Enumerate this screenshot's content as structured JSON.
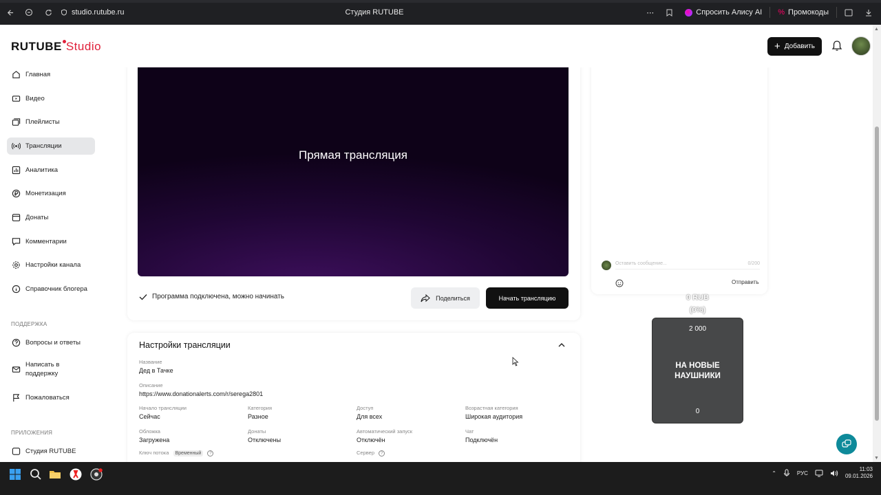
{
  "browser": {
    "url": "studio.rutube.ru",
    "page_title": "Студия RUTUBE",
    "alice_label": "Спросить Алису AI",
    "promo_label": "Промокоды"
  },
  "header": {
    "logo_main": "RUTUBE",
    "logo_studio": "Studio",
    "add_label": "Добавить"
  },
  "sidebar": {
    "items": [
      {
        "label": "Главная"
      },
      {
        "label": "Видео"
      },
      {
        "label": "Плейлисты"
      },
      {
        "label": "Трансляции"
      },
      {
        "label": "Аналитика"
      },
      {
        "label": "Монетизация"
      },
      {
        "label": "Донаты"
      },
      {
        "label": "Комментарии"
      },
      {
        "label": "Настройки канала"
      },
      {
        "label": "Справочник блогера"
      }
    ],
    "support_title": "ПОДДЕРЖКА",
    "support_items": [
      {
        "label": "Вопросы и ответы"
      },
      {
        "label": "Написать в поддержку"
      },
      {
        "label": "Пожаловаться"
      }
    ],
    "apps_title": "ПРИЛОЖЕНИЯ",
    "apps_items": [
      {
        "label": "Студия RUTUBE"
      }
    ]
  },
  "stream": {
    "preview_title": "Прямая трансляция",
    "status_text": "Программа подключена, можно начинать",
    "share_label": "Поделиться",
    "start_label": "Начать трансляцию"
  },
  "settings": {
    "title": "Настройки трансляции",
    "name_label": "Название",
    "name_value": "Дед в Тачке",
    "desc_label": "Описание",
    "desc_value": "https://www.donationalerts.com/r/serega2801",
    "start_label": "Начало трансляции",
    "start_value": "Сейчас",
    "category_label": "Категория",
    "category_value": "Разное",
    "access_label": "Доступ",
    "access_value": "Для всех",
    "age_label": "Возрастная категория",
    "age_value": "Широкая аудитория",
    "cover_label": "Обложка",
    "cover_value": "Загружена",
    "donates_label": "Донаты",
    "donates_value": "Отключены",
    "autostart_label": "Автоматический запуск",
    "autostart_value": "Отключён",
    "chat_label": "Чат",
    "chat_value": "Подключён",
    "key_label": "Ключ потока",
    "key_badge": "Временный",
    "server_label": "Сервер"
  },
  "chat": {
    "placeholder": "Оставить сообщение...",
    "counter": "0/200",
    "send_label": "Отправить"
  },
  "donation_widget": {
    "amount_line1": "0 RUB",
    "amount_line2": "(0%)",
    "goal": "2 000",
    "text_line1": "НА НОВЫЕ",
    "text_line2": "НАУШНИКИ",
    "current": "0"
  },
  "taskbar": {
    "lang": "РУС",
    "time": "11:03",
    "date": "09.01.2026"
  }
}
